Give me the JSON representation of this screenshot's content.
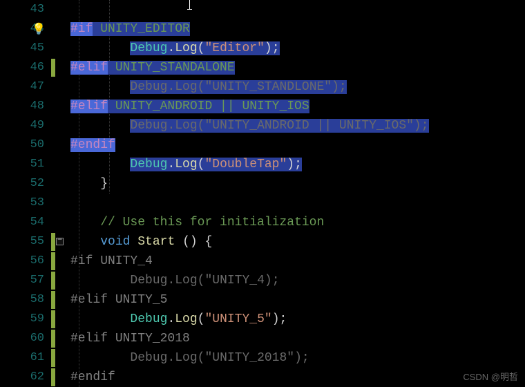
{
  "gutter": {
    "lines": [
      "43",
      "44",
      "45",
      "46",
      "47",
      "48",
      "49",
      "50",
      "51",
      "52",
      "53",
      "54",
      "55",
      "56",
      "57",
      "58",
      "59",
      "60",
      "61",
      "62"
    ]
  },
  "code": {
    "l44": {
      "kw": "#if",
      "sym": " UNITY_EDITOR"
    },
    "l45": {
      "type": "Debug",
      "dot": ".",
      "fn": "Log",
      "open": "(",
      "str": "\"Editor\"",
      "close": ");"
    },
    "l46": {
      "kw": "#elif",
      "sym": " UNITY_STANDALONE"
    },
    "l47": {
      "type": "Debug",
      "dot": ".",
      "fn": "Log",
      "open": "(",
      "str": "\"UNITY_STANDLONE\"",
      "close": ");"
    },
    "l48": {
      "kw": "#elif",
      "sym": " UNITY_ANDROID || UNITY_IOS"
    },
    "l49": {
      "type": "Debug",
      "dot": ".",
      "fn": "Log",
      "open": "(",
      "str": "\"UNITY_ANDROID || UNITY_IOS\"",
      "close": ");"
    },
    "l50": {
      "kw": "#endif"
    },
    "l51": {
      "type": "Debug",
      "dot": ".",
      "fn": "Log",
      "open": "(",
      "str": "\"DoubleTap\"",
      "close": ");"
    },
    "l52": {
      "brace": "}"
    },
    "l54": {
      "cmt": "// Use this for initialization"
    },
    "l55": {
      "void": "void",
      "fn": " Start ",
      "rest": "() {"
    },
    "l56": {
      "kw": "#if",
      "sym": " UNITY_4"
    },
    "l57": {
      "type": "Debug",
      "dot": ".",
      "fn": "Log",
      "open": "(",
      "str": "\"UNITY_4)",
      "close": ";"
    },
    "l58": {
      "kw": "#elif",
      "sym": " UNITY_5"
    },
    "l59": {
      "type": "Debug",
      "dot": ".",
      "fn": "Log",
      "open": "(",
      "str": "\"UNITY_5\"",
      "close": ");"
    },
    "l60": {
      "kw": "#elif",
      "sym": " UNITY_2018"
    },
    "l61": {
      "type": "Debug",
      "dot": ".",
      "fn": "Log",
      "open": "(",
      "str": "\"UNITY_2018\"",
      "close": ");"
    },
    "l62": {
      "kw": "#endif"
    }
  },
  "watermark": "CSDN @明哲"
}
